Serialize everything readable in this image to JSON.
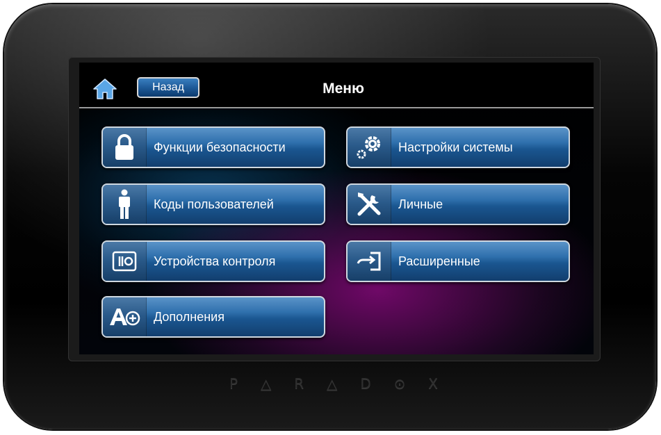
{
  "device": {
    "brand_letters": [
      "P",
      "△",
      "R",
      "△",
      "D",
      "⊙",
      "X"
    ]
  },
  "header": {
    "back_label": "Назад",
    "title": "Меню"
  },
  "menu": {
    "items": [
      {
        "label": "Функции безопасности",
        "icon": "lock-icon"
      },
      {
        "label": "Настройки системы",
        "icon": "gears-icon"
      },
      {
        "label": "Коды пользователей",
        "icon": "user-icon"
      },
      {
        "label": "Личные",
        "icon": "tools-icon"
      },
      {
        "label": "Устройства контроля",
        "icon": "switch-icon"
      },
      {
        "label": "Расширенные",
        "icon": "login-arrow-icon"
      },
      {
        "label": "Дополнения",
        "icon": "add-on-icon"
      }
    ]
  },
  "colors": {
    "button_blue": "#2f70ad",
    "screen_glow_magenta": "#820a78",
    "screen_glow_blue": "#0a466e"
  }
}
